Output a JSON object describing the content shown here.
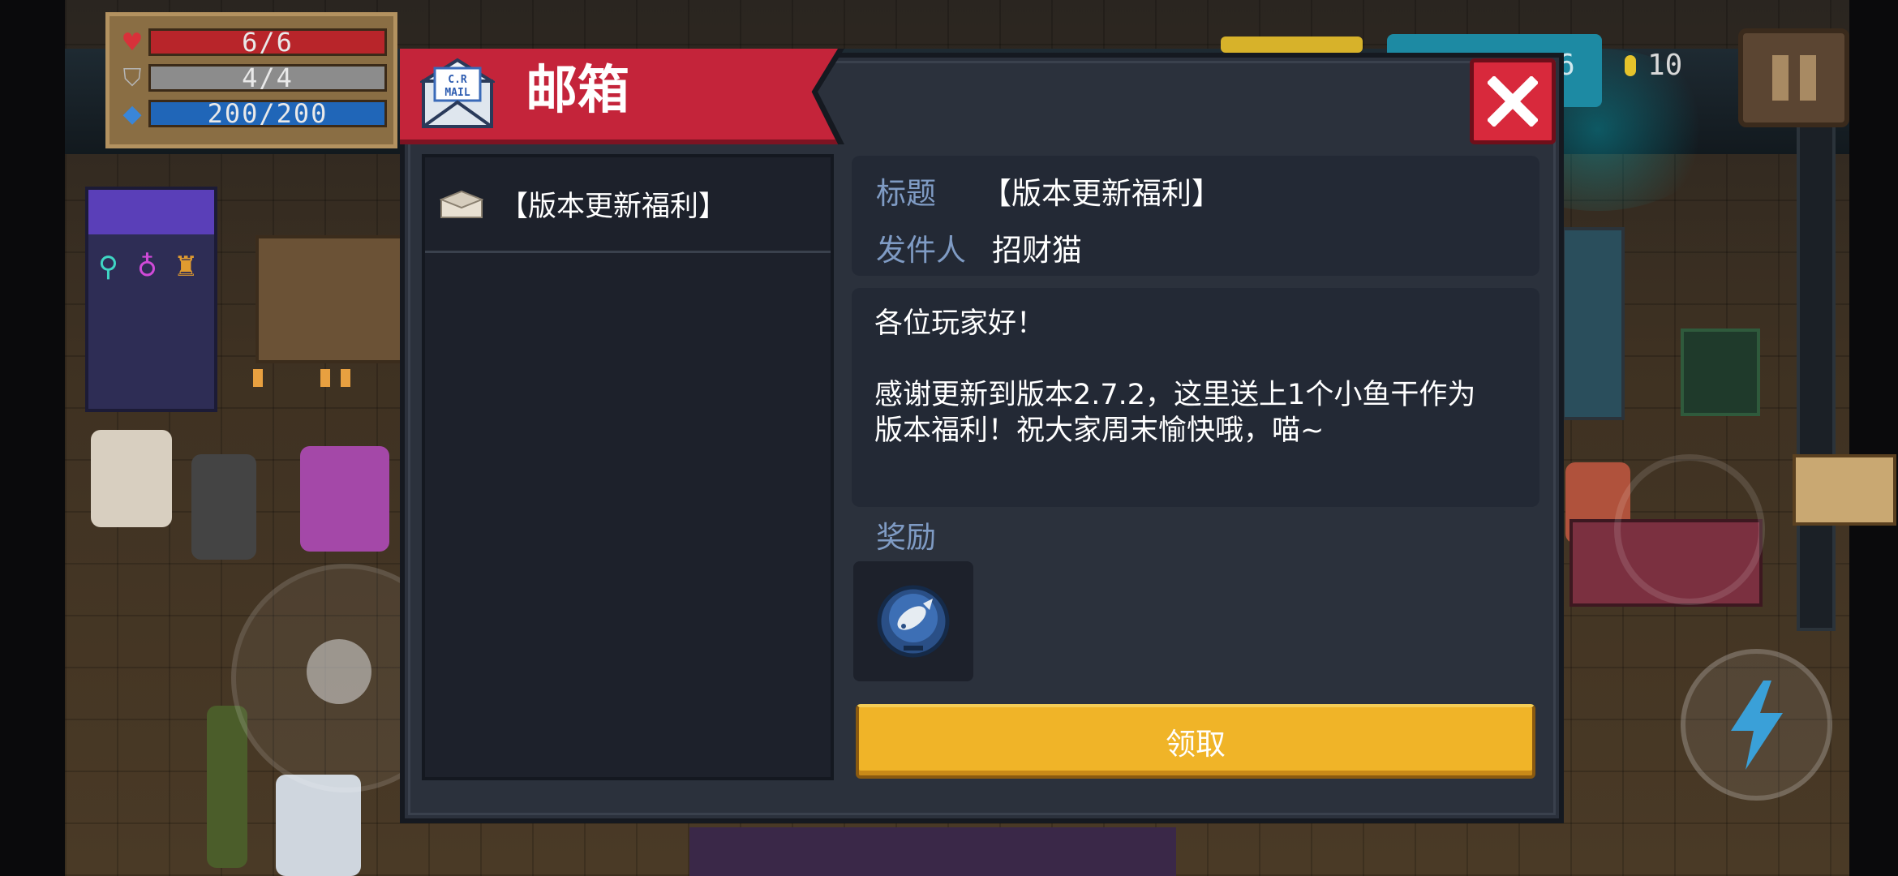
{
  "hud": {
    "hp": "6/6",
    "armor": "4/4",
    "energy": "200/200",
    "teal_counter": "6",
    "coins": "10"
  },
  "mailbox": {
    "title": "邮箱",
    "list_items": [
      {
        "label": "【版本更新福利】"
      }
    ],
    "detail": {
      "subject_label": "标题",
      "subject_value": "【版本更新福利】",
      "sender_label": "发件人",
      "sender_value": "招财猫",
      "body_lines": [
        "各位玩家好！",
        "",
        "感谢更新到版本2.7.2，这里送上1个小鱼干作为",
        "版本福利！祝大家周末愉快哦，喵~"
      ],
      "reward_label": "奖励",
      "claim_button": "领取"
    }
  },
  "colors": {
    "banner_red": "#c4243a",
    "dialog_bg": "#2b313c",
    "label_blue": "#7f9bc4",
    "claim_yellow": "#f0b428",
    "close_red": "#d8293c"
  },
  "icons": {
    "mail": "mail-envelope-icon",
    "close": "close-x-icon",
    "envelope": "envelope-icon",
    "reward": "fish-coin-icon",
    "skill": "lightning-icon",
    "pause": "pause-icon"
  }
}
